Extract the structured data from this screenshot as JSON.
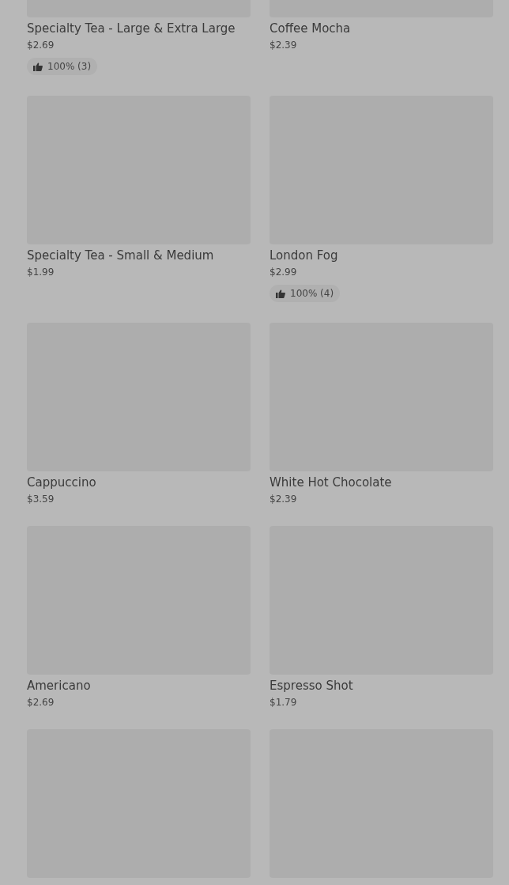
{
  "items": [
    {
      "kind": "product",
      "name": "Specialty Tea - Large & Extra Large",
      "price": "$2.69",
      "rating": "100% (3)"
    },
    {
      "kind": "product",
      "name": "Coffee Mocha",
      "price": "$2.39"
    },
    {
      "kind": "product",
      "name": "Specialty Tea - Small & Medium",
      "price": "$1.99"
    },
    {
      "kind": "product",
      "name": "London Fog",
      "price": "$2.99",
      "rating": "100% (4)"
    },
    {
      "kind": "product",
      "name": "Cappuccino",
      "price": "$3.59"
    },
    {
      "kind": "product",
      "name": "White Hot Chocolate",
      "price": "$2.39"
    },
    {
      "kind": "product",
      "name": "Americano",
      "price": "$2.69"
    },
    {
      "kind": "product",
      "name": "Espresso Shot",
      "price": "$1.79"
    },
    {
      "kind": "product"
    },
    {
      "kind": "product"
    }
  ]
}
